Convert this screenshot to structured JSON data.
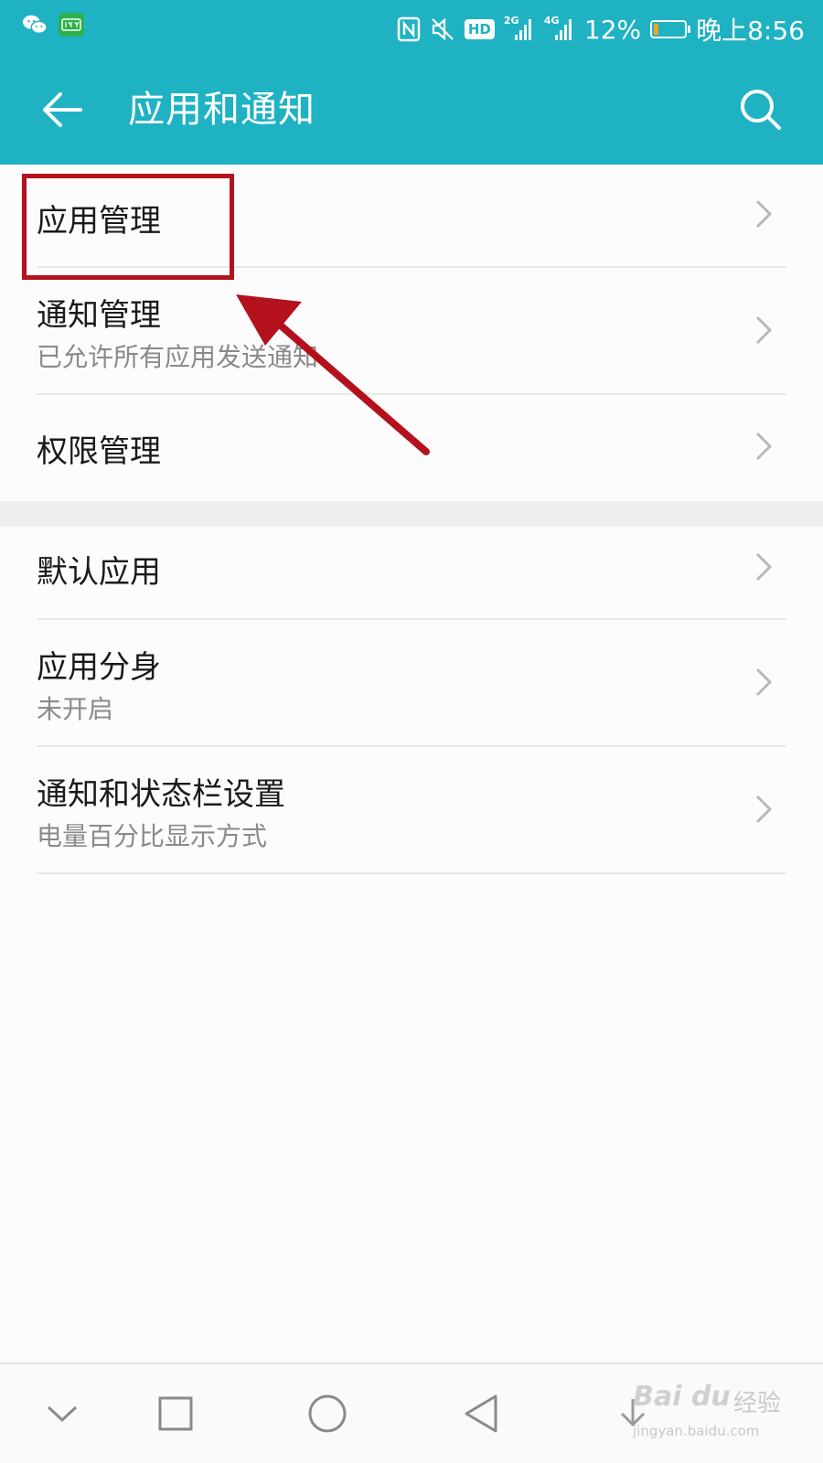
{
  "status_bar": {
    "battery_percent": "12%",
    "battery_level": 0.12,
    "time": "晚上8:56",
    "hd_label": "HD",
    "net1_label": "2G",
    "net2_label": "4G",
    "left_icons": [
      "wechat-icon",
      "iqiyi-icon"
    ],
    "right_icons": [
      "nfc-icon",
      "mute-icon",
      "hd-icon",
      "signal-2g-icon",
      "signal-4g-icon",
      "battery-icon"
    ]
  },
  "app_bar": {
    "title": "应用和通知",
    "back_icon": "arrow-left",
    "search_icon": "magnifier",
    "background": "#1fb2c2"
  },
  "list": {
    "group1": [
      {
        "label": "应用管理",
        "sub": ""
      },
      {
        "label": "通知管理",
        "sub": "已允许所有应用发送通知"
      },
      {
        "label": "权限管理",
        "sub": ""
      }
    ],
    "group2": [
      {
        "label": "默认应用",
        "sub": ""
      },
      {
        "label": "应用分身",
        "sub": "未开启"
      },
      {
        "label": "通知和状态栏设置",
        "sub": "电量百分比显示方式"
      }
    ]
  },
  "nav_bar": {
    "icons": [
      "hide-chevron-icon",
      "recents-square-icon",
      "home-circle-icon",
      "back-triangle-icon",
      "pull-down-icon"
    ]
  },
  "annotation": {
    "highlight_color": "#b3121d",
    "highlight_target": "应用管理"
  },
  "watermark": {
    "brand": "Bai du",
    "cn": "经验",
    "url": "jingyan.baidu.com"
  }
}
